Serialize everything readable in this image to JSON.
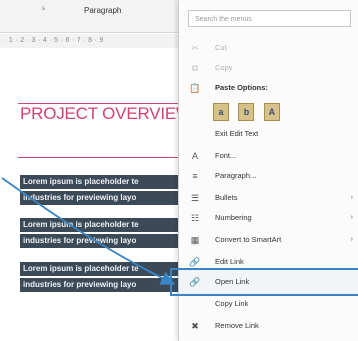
{
  "ribbon": {
    "group_label": "Paragraph",
    "launcher": "⁵",
    "ruler_text": "· 1 · 2 · 3 · 4 · 5 · 6 · 7 · 8 · 9"
  },
  "document": {
    "heading": "PROJECT OVERVIEW",
    "selected_lines": [
      "Lorem ipsum is placeholder te",
      "industries for previewing layo",
      "Lorem ipsum is placeholder te",
      "industries for previewing layo",
      "Lorem ipsum is placeholder te",
      "industries for previewing layo"
    ]
  },
  "context_menu": {
    "search_placeholder": "Search the menus",
    "items": [
      {
        "label": "Cut",
        "icon": "scissors-icon",
        "glyph": "✂",
        "disabled": true
      },
      {
        "label": "Copy",
        "icon": "copy-icon",
        "glyph": "⧉",
        "disabled": true
      },
      {
        "label": "Paste Options:",
        "icon": "clipboard-icon",
        "glyph": "📋",
        "bold": true
      },
      {
        "label": "Exit Edit Text",
        "icon": "",
        "glyph": ""
      },
      {
        "label": "Font...",
        "icon": "font-icon",
        "glyph": "A"
      },
      {
        "label": "Paragraph...",
        "icon": "paragraph-icon",
        "glyph": "≡"
      },
      {
        "label": "Bullets",
        "icon": "bullets-icon",
        "glyph": "☰",
        "submenu": "›"
      },
      {
        "label": "Numbering",
        "icon": "numbering-icon",
        "glyph": "☷",
        "submenu": "›"
      },
      {
        "label": "Convert to SmartArt",
        "icon": "smartart-icon",
        "glyph": "▦",
        "submenu": "›"
      },
      {
        "label": "Edit Link",
        "icon": "edit-link-icon",
        "glyph": "🔗"
      },
      {
        "label": "Open Link",
        "icon": "open-link-icon",
        "glyph": "🔗"
      },
      {
        "label": "Copy Link",
        "icon": "",
        "glyph": ""
      },
      {
        "label": "Remove Link",
        "icon": "remove-link-icon",
        "glyph": "✖"
      }
    ],
    "paste_icons": [
      "a",
      "b",
      "A"
    ]
  },
  "colors": {
    "heading": "#d0436e",
    "selection": "#3c4a58",
    "highlight": "#3b84c4"
  }
}
